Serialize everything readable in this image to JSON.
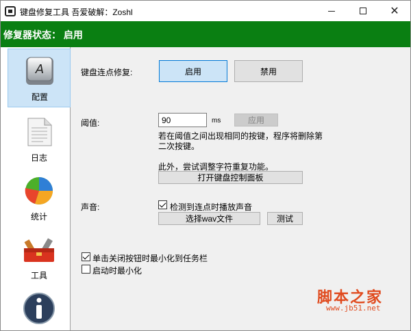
{
  "window": {
    "title": "键盘修复工具 吾爱破解：Zoshl",
    "icon": "keyboard-app-icon",
    "controls": {
      "minimize": "minimize-icon",
      "maximize": "maximize-icon",
      "close_glyph": "✕"
    }
  },
  "status": {
    "text": "修复器状态： 启用",
    "color": "#0a7f12"
  },
  "sidebar": {
    "items": [
      {
        "label": "配置",
        "icon": "key-a-icon",
        "active": true
      },
      {
        "label": "日志",
        "icon": "document-icon",
        "active": false
      },
      {
        "label": "统计",
        "icon": "pie-chart-icon",
        "active": false
      },
      {
        "label": "工具",
        "icon": "toolbox-icon",
        "active": false
      },
      {
        "label": "",
        "icon": "info-icon",
        "active": false
      }
    ]
  },
  "main": {
    "repair": {
      "label": "键盘连点修复:",
      "enable": "启用",
      "disable": "禁用"
    },
    "threshold": {
      "label": "阈值:",
      "value": "90",
      "unit": "ms",
      "apply": "应用",
      "desc_line1": "若在阈值之间出现相同的按键，程序将删除第",
      "desc_line2": "二次按键。"
    },
    "extra": {
      "text": "此外，尝试调整字符重复功能。",
      "open_panel": "打开键盘控制面板"
    },
    "sound": {
      "label": "声音:",
      "play_checkbox": "检测到连点时播放声音",
      "choose_wav": "选择wav文件",
      "test": "测试"
    },
    "options": {
      "minimize_to_tray": "单击关闭按钮时最小化到任务栏",
      "start_minimized": "启动时最小化"
    }
  },
  "watermark": {
    "cn": "脚本之家",
    "url": "www.jb51.net",
    "color": "#e04a1e"
  }
}
